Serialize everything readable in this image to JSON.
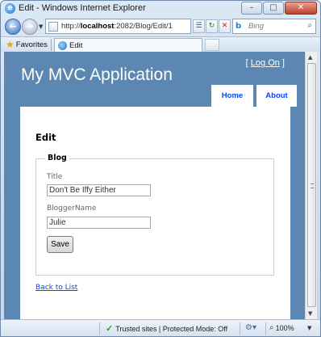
{
  "window": {
    "title": "Edit - Windows Internet Explorer",
    "controls": {
      "minimize": "–",
      "maximize": "□",
      "close": "✕"
    }
  },
  "navigation": {
    "url_prefix": "http://",
    "url_host": "localhost",
    "url_rest": ":2082/Blog/Edit/1",
    "search_placeholder": "Bing",
    "icons": {
      "back": "←",
      "forward": "→",
      "refresh": "↻",
      "stop": "✕",
      "search_go": "⌕",
      "compat": "☰"
    }
  },
  "favorites_bar": {
    "favorites_label": "Favorites",
    "tab_title": "Edit"
  },
  "site": {
    "login_prefix": "[ ",
    "login_link": "Log On",
    "login_suffix": " ]",
    "app_title": "My MVC Application",
    "menu": [
      {
        "label": "Home"
      },
      {
        "label": "About"
      }
    ]
  },
  "page": {
    "heading": "Edit",
    "legend": "Blog",
    "fields": {
      "title": {
        "label": "Title",
        "value": "Don't Be Iffy Either"
      },
      "blogger": {
        "label": "BloggerName",
        "value": "Julie"
      }
    },
    "save_label": "Save",
    "back_link": "Back to List"
  },
  "status": {
    "zone": "Trusted sites | Protected Mode: Off",
    "zoom": "100%"
  },
  "colors": {
    "header_bg": "#5c87b2",
    "menu_text": "#034af3",
    "link": "#034af3"
  }
}
